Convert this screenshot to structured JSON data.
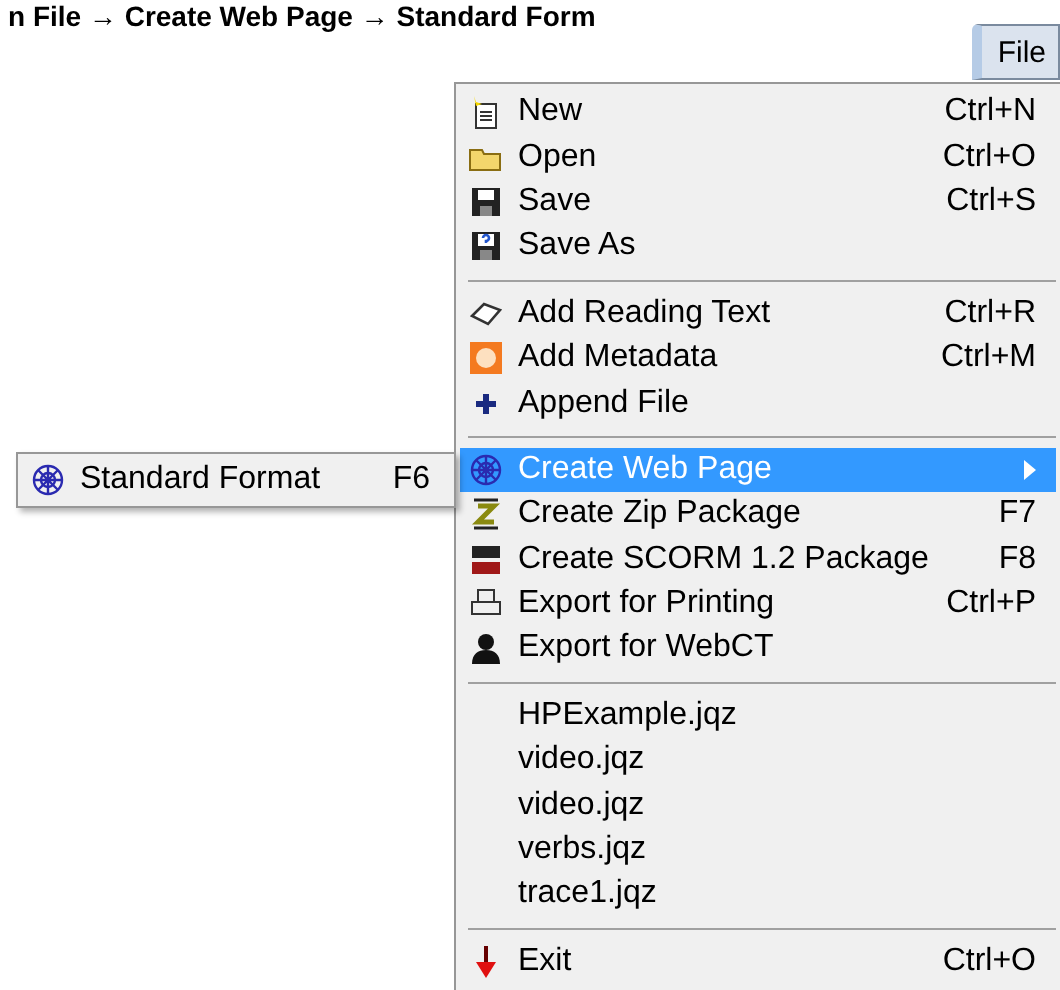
{
  "heading": "n File → Create Web Page → Standard Form",
  "menu_button": {
    "label": "File",
    "pressed": true
  },
  "menu": {
    "sections": [
      [
        {
          "label": "New",
          "shortcut": "Ctrl+N",
          "selected": false,
          "submenu": false
        },
        {
          "label": "Open",
          "shortcut": "Ctrl+O",
          "selected": false,
          "submenu": false
        },
        {
          "label": "Save",
          "shortcut": "Ctrl+S",
          "selected": false,
          "submenu": false
        },
        {
          "label": "Save As",
          "selected": false,
          "submenu": false
        }
      ],
      [
        {
          "label": "Add Reading Text",
          "shortcut": "Ctrl+R",
          "selected": false,
          "submenu": false
        },
        {
          "label": "Add Metadata",
          "shortcut": "Ctrl+M",
          "selected": false,
          "submenu": false
        },
        {
          "label": "Append File",
          "selected": false,
          "submenu": false
        }
      ],
      [
        {
          "label": "Create Web Page",
          "selected": true,
          "submenu": true
        },
        {
          "label": "Create Zip Package",
          "shortcut": "F7",
          "selected": false,
          "submenu": false
        },
        {
          "label": "Create SCORM 1.2 Package",
          "shortcut": "F8",
          "selected": false,
          "submenu": false
        },
        {
          "label": "Export for Printing",
          "shortcut": "Ctrl+P",
          "selected": false,
          "submenu": false
        },
        {
          "label": "Export for WebCT",
          "selected": false,
          "submenu": false
        }
      ],
      [
        {
          "label": "HPExample.jqz",
          "selected": false,
          "submenu": false
        },
        {
          "label": "video.jqz",
          "selected": false,
          "submenu": false
        },
        {
          "label": "video.jqz",
          "selected": false,
          "submenu": false
        },
        {
          "label": "verbs.jqz",
          "selected": false,
          "submenu": false
        },
        {
          "label": "trace1.jqz",
          "selected": false,
          "submenu": false
        }
      ],
      [
        {
          "label": "Exit",
          "shortcut": "Ctrl+O",
          "selected": false,
          "submenu": false
        }
      ]
    ]
  },
  "submenu": {
    "items": [
      {
        "label": "Standard Format",
        "shortcut": "F6",
        "selected": false
      }
    ]
  }
}
